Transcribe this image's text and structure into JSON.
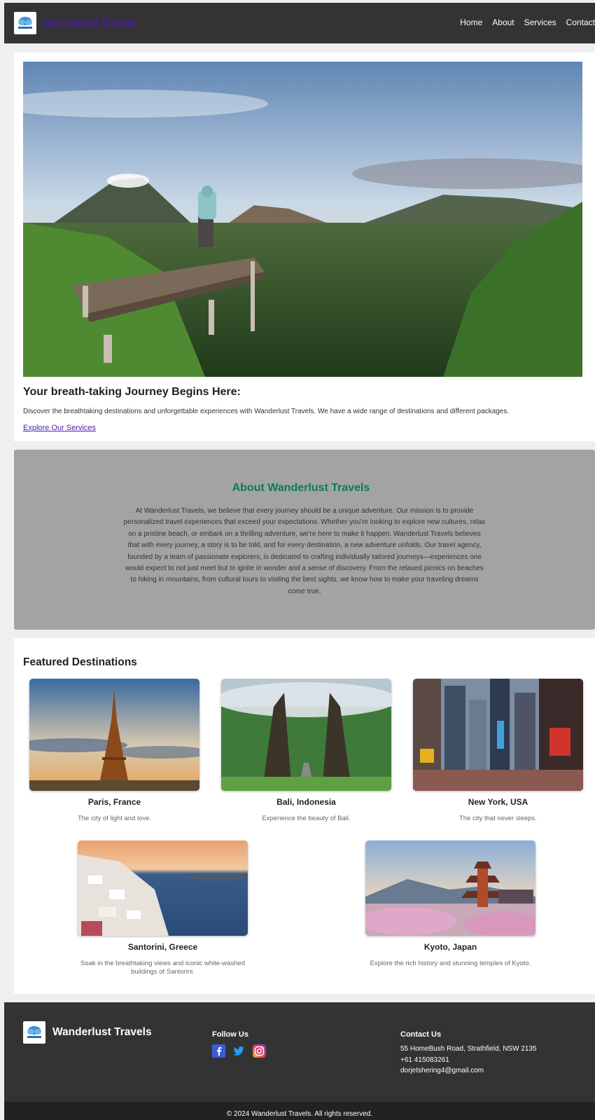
{
  "header": {
    "brand": "Wanderlust Travels",
    "nav": [
      "Home",
      "About",
      "Services",
      "Contact"
    ]
  },
  "hero": {
    "image_icon": "mountain-landscape-photo",
    "title": "Your breath-taking Journey Begins Here:",
    "text": "Discover the breathtaking destinations and unforgettable experiences with Wanderlust Travels. We have a wide range of destinations and different packages.",
    "link": "Explore Our Services"
  },
  "about": {
    "title": "About Wanderlust Travels",
    "text": "At Wanderlust Travels, we believe that every journey should be a unique adventure. Our mission is to provide personalized travel experiences that exceed your expectations. Whether you're looking to explore new cultures, relax on a pristine beach, or embark on a thrilling adventure, we're here to make it happen. Wanderlust Travels believes that with every journey, a story is to be told, and for every destination, a new adventure unfolds. Our travel agency, founded by a team of passionate explorers, is dedicated to crafting individually tailored journeys—experiences one would expect to not just meet but to ignite in wonder and a sense of discovery. From the relaxed picnics on beaches to hiking in mountains, from cultural tours to visiting the best sights, we know how to make your traveling dreams come true."
  },
  "featured": {
    "title": "Featured Destinations",
    "destinations": [
      {
        "name": "Paris, France",
        "desc": "The city of light and love."
      },
      {
        "name": "Bali, Indonesia",
        "desc": "Experience the beauty of Bali."
      },
      {
        "name": "New York, USA",
        "desc": "The city that never sleeps."
      },
      {
        "name": "Santorini, Greece",
        "desc": "Soak in the breathtaking views and iconic white-washed buildings of Santorini."
      },
      {
        "name": "Kyoto, Japan",
        "desc": "Explore the rich history and stunning temples of Kyoto."
      }
    ]
  },
  "footer": {
    "brand": "Wanderlust Travels",
    "follow_title": "Follow Us",
    "social": [
      "facebook-icon",
      "twitter-icon",
      "instagram-icon"
    ],
    "contact_title": "Contact Us",
    "address": "55 HomeBush Road, Strathfield, NSW 2135",
    "phone": "+61 415083261",
    "email": "dorjetshering4@gmail.com",
    "copyright": "© 2024 Wanderlust Travels. All rights reserved."
  },
  "colors": {
    "header_bg": "#333333",
    "about_bg": "#a3a3a3",
    "about_title": "#0d7a5f",
    "link": "#4b1fa8"
  }
}
